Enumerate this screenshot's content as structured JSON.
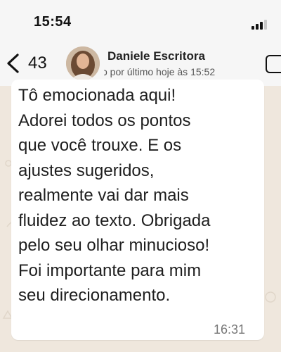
{
  "status_bar": {
    "time": "15:54"
  },
  "header": {
    "back_count": "43",
    "contact_name": "Daniele Escritora",
    "last_seen": "o por último hoje às 15:52"
  },
  "message": {
    "lines": [
      "Tô emocionada aqui!",
      "Adorei todos os pontos",
      "que você trouxe. E os",
      "ajustes sugeridos,",
      "realmente vai dar mais",
      "fluidez ao texto. Obrigada",
      "pelo seu olhar minucioso!",
      "Foi importante para mim",
      "seu direcionamento."
    ],
    "time": "16:31"
  },
  "icons": {
    "back": "chevron-left-icon",
    "signal": "signal-bars-icon",
    "video": "video-call-icon"
  },
  "colors": {
    "chat_background": "#efe7dd",
    "bubble": "#ffffff",
    "header": "#f6f6f6"
  }
}
